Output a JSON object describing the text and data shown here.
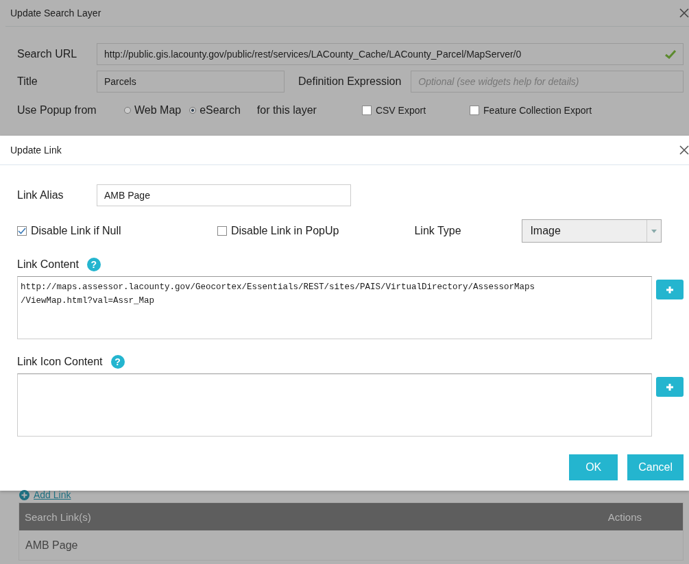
{
  "search_layer_dialog": {
    "title": "Update Search Layer",
    "search_url": {
      "label": "Search URL",
      "value": "http://public.gis.lacounty.gov/public/rest/services/LACounty_Cache/LACounty_Parcel/MapServer/0",
      "valid": true
    },
    "title_field": {
      "label": "Title",
      "value": "Parcels"
    },
    "definition_expression": {
      "label": "Definition Expression",
      "placeholder": "Optional (see widgets help for details)"
    },
    "popup": {
      "label": "Use Popup from",
      "options": [
        {
          "label": "Web Map",
          "selected": false
        },
        {
          "label": "eSearch",
          "selected": true
        }
      ],
      "suffix": "for this layer"
    },
    "exports": [
      {
        "label": "CSV Export",
        "checked": false
      },
      {
        "label": "Feature Collection Export",
        "checked": false
      }
    ],
    "add_link": "Add Link",
    "links_table": {
      "columns": [
        "Search Link(s)",
        "Actions"
      ],
      "rows": [
        [
          "AMB Page"
        ]
      ]
    }
  },
  "link_dialog": {
    "title": "Update Link",
    "alias": {
      "label": "Link Alias",
      "value": "AMB Page"
    },
    "options": [
      {
        "label": "Disable Link if Null",
        "checked": true
      },
      {
        "label": "Disable Link in PopUp",
        "checked": false
      }
    ],
    "link_type": {
      "label": "Link Type",
      "value": "Image"
    },
    "link_content": {
      "label": "Link Content",
      "help": "?",
      "value": "http://maps.assessor.lacounty.gov/Geocortex/Essentials/REST/sites/PAIS/VirtualDirectory/AssessorMaps\n/ViewMap.html?val=Assr_Map"
    },
    "link_icon_content": {
      "label": "Link Icon Content",
      "help": "?"
    },
    "buttons": [
      "OK",
      "Cancel"
    ]
  }
}
